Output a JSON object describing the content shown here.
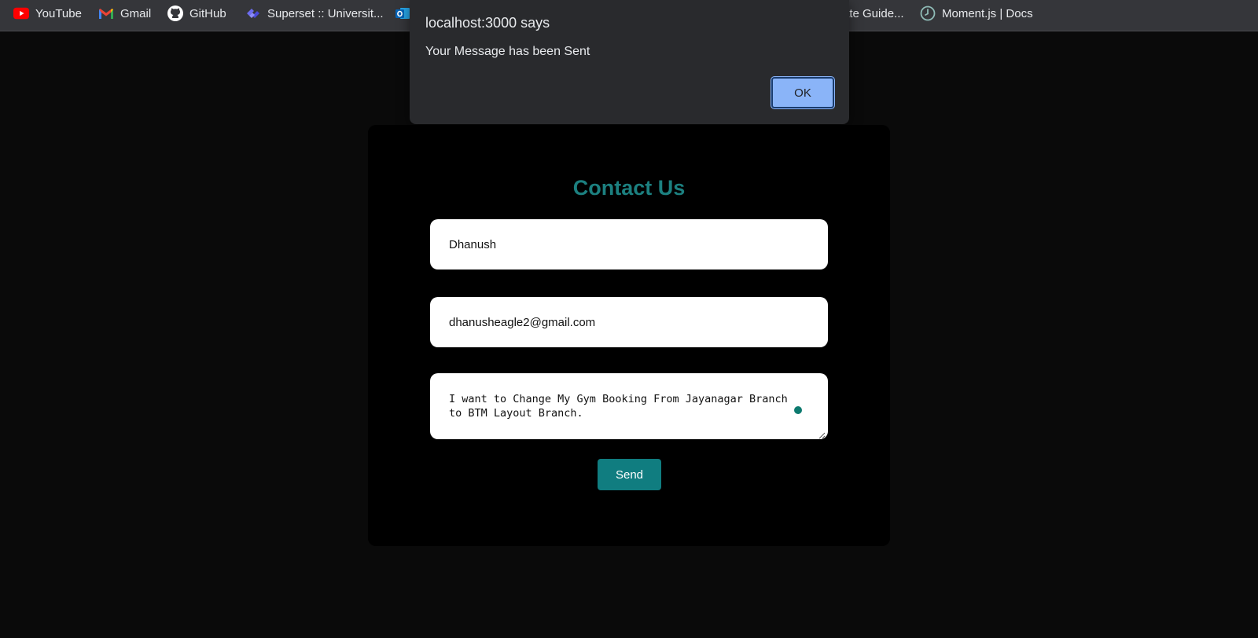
{
  "bookmarks": [
    {
      "label": "YouTube",
      "icon": "youtube-icon"
    },
    {
      "label": "Gmail",
      "icon": "gmail-icon"
    },
    {
      "label": "GitHub",
      "icon": "github-icon"
    },
    {
      "label": "Superset :: Universit...",
      "icon": "superset-icon"
    },
    {
      "label": "",
      "icon": "outlook-icon"
    },
    {
      "label": "ate Guide...",
      "icon": ""
    },
    {
      "label": "Moment.js | Docs",
      "icon": "clock-icon"
    }
  ],
  "alert": {
    "title": "localhost:3000 says",
    "message": "Your Message has been Sent",
    "ok_label": "OK"
  },
  "contact": {
    "title": "Contact Us",
    "name_value": "Dhanush",
    "email_value": "dhanusheagle2@gmail.com",
    "message_value": "I want to Change My Gym Booking From Jayanagar Branch to BTM Layout Branch.",
    "send_label": "Send"
  },
  "colors": {
    "accent": "#107d80",
    "title": "#1c8080",
    "dialog_bg": "#292a2d",
    "ok_button": "#8ab4f8"
  }
}
